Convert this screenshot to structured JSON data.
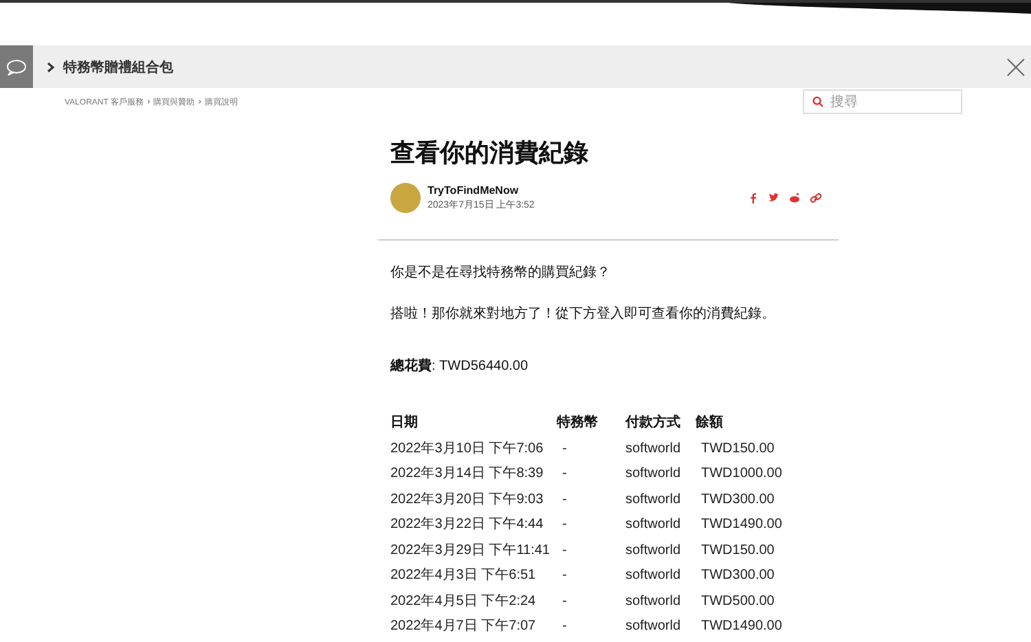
{
  "notice_bar": {
    "title": "特務幣贈禮組合包"
  },
  "breadcrumb": [
    "VALORANT 客戶服務",
    "購買與贊助",
    "購買說明"
  ],
  "search": {
    "placeholder": "搜尋"
  },
  "article": {
    "title": "查看你的消費紀錄",
    "author": "TryToFindMeNow",
    "date": "2023年7月15日 上午3:52",
    "paragraphs": [
      "你是不是在尋找特務幣的購買紀錄？",
      "搭啦！那你就來對地方了！從下方登入即可查看你的消費紀錄。"
    ],
    "total": "**總花費**: TWD56440.00"
  },
  "table": {
    "columns": [
      "日期",
      "特務幣",
      "付款方式",
      "餘額"
    ],
    "rows": [
      [
        "2022年3月10日 下午7:06",
        "-",
        "softworld",
        "TWD150.00"
      ],
      [
        "2022年3月14日 下午8:39",
        "-",
        "softworld",
        "TWD1000.00"
      ],
      [
        "2022年3月20日 下午9:03",
        "-",
        "softworld",
        "TWD300.00"
      ],
      [
        "2022年3月22日 下午4:44",
        "-",
        "softworld",
        "TWD1490.00"
      ],
      [
        "2022年3月29日 下午11:41",
        "-",
        "softworld",
        "TWD150.00"
      ],
      [
        "2022年4月3日 下午6:51",
        "-",
        "softworld",
        "TWD300.00"
      ],
      [
        "2022年4月5日 下午2:24",
        "-",
        "softworld",
        "TWD500.00"
      ],
      [
        "2022年4月7日 下午7:07",
        "-",
        "softworld",
        "TWD1490.00"
      ]
    ]
  }
}
